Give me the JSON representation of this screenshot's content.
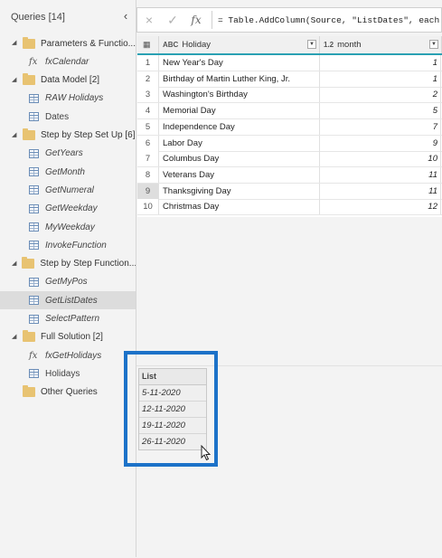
{
  "queries_pane": {
    "title": "Queries [14]",
    "collapse_icon": "chevron-left-icon",
    "items": [
      {
        "kind": "group",
        "label": "Parameters & Functio..."
      },
      {
        "kind": "query",
        "icon": "fx-icon",
        "label": "fxCalendar",
        "italic": true
      },
      {
        "kind": "group",
        "label": "Data Model [2]"
      },
      {
        "kind": "query",
        "icon": "table-icon",
        "label": "RAW Holidays",
        "italic": true
      },
      {
        "kind": "query",
        "icon": "table-icon",
        "label": "Dates",
        "italic": false
      },
      {
        "kind": "group",
        "label": "Step by Step Set Up [6]"
      },
      {
        "kind": "query",
        "icon": "table-icon",
        "label": "GetYears",
        "italic": true
      },
      {
        "kind": "query",
        "icon": "table-icon",
        "label": "GetMonth",
        "italic": true
      },
      {
        "kind": "query",
        "icon": "table-icon",
        "label": "GetNumeral",
        "italic": true
      },
      {
        "kind": "query",
        "icon": "table-icon",
        "label": "GetWeekday",
        "italic": true
      },
      {
        "kind": "query",
        "icon": "table-icon",
        "label": "MyWeekday",
        "italic": true
      },
      {
        "kind": "query",
        "icon": "table-icon",
        "label": "InvokeFunction",
        "italic": true
      },
      {
        "kind": "group",
        "label": "Step by Step Function..."
      },
      {
        "kind": "query",
        "icon": "table-icon",
        "label": "GetMyPos",
        "italic": true
      },
      {
        "kind": "query",
        "icon": "table-icon",
        "label": "GetListDates",
        "italic": true,
        "selected": true
      },
      {
        "kind": "query",
        "icon": "table-icon",
        "label": "SelectPattern",
        "italic": true
      },
      {
        "kind": "group",
        "label": "Full Solution [2]"
      },
      {
        "kind": "query",
        "icon": "fx-icon",
        "label": "fxGetHolidays",
        "italic": true
      },
      {
        "kind": "query",
        "icon": "table-icon",
        "label": "Holidays",
        "italic": false
      },
      {
        "kind": "folder",
        "label": "Other Queries"
      }
    ]
  },
  "formula_bar": {
    "cancel_icon": "×",
    "confirm_icon": "✓",
    "fx_label": "fx",
    "formula": "= Table.AddColumn(Source, \"ListDates\", each"
  },
  "grid": {
    "columns": [
      {
        "type_icon": "ABC",
        "label": "Holiday"
      },
      {
        "type_icon": "1.2",
        "label": "month"
      }
    ],
    "rows": [
      {
        "n": "1",
        "holiday": "New Year's Day",
        "month": "1"
      },
      {
        "n": "2",
        "holiday": "Birthday of Martin Luther King, Jr.",
        "month": "1"
      },
      {
        "n": "3",
        "holiday": "Washington's Birthday",
        "month": "2"
      },
      {
        "n": "4",
        "holiday": "Memorial Day",
        "month": "5"
      },
      {
        "n": "5",
        "holiday": "Independence Day",
        "month": "7"
      },
      {
        "n": "6",
        "holiday": "Labor Day",
        "month": "9"
      },
      {
        "n": "7",
        "holiday": "Columbus Day",
        "month": "10"
      },
      {
        "n": "8",
        "holiday": "Veterans Day",
        "month": "11"
      },
      {
        "n": "9",
        "holiday": "Thanksgiving Day",
        "month": "11"
      },
      {
        "n": "10",
        "holiday": "Christmas Day",
        "month": "12"
      }
    ],
    "highlighted_row": "9"
  },
  "preview": {
    "header": "List",
    "values": [
      "5-11-2020",
      "12-11-2020",
      "19-11-2020",
      "26-11-2020"
    ],
    "highlight_color": "#1c72c8"
  }
}
